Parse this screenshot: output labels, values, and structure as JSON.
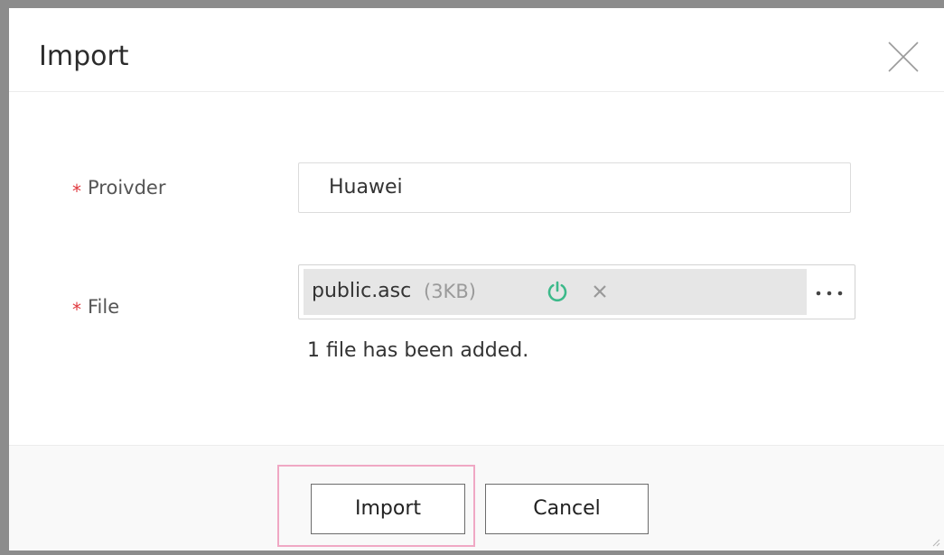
{
  "dialog": {
    "title": "Import",
    "close_icon": "close-icon"
  },
  "form": {
    "provider": {
      "required_mark": "*",
      "label": "Proivder",
      "value": "Huawei"
    },
    "file": {
      "required_mark": "*",
      "label": "File",
      "file_name": "public.asc",
      "file_size": "(3KB)",
      "status_icon": "power-icon",
      "status_color": "#3cb98a",
      "remove_icon": "close-small-icon",
      "browse_icon": "more-dots-icon",
      "status_text": "1 file has been added."
    }
  },
  "footer": {
    "import_label": "Import",
    "cancel_label": "Cancel",
    "highlight_color": "#f0a8c4"
  },
  "colors": {
    "required": "#e0393e",
    "frame": "#8c8c8c"
  }
}
